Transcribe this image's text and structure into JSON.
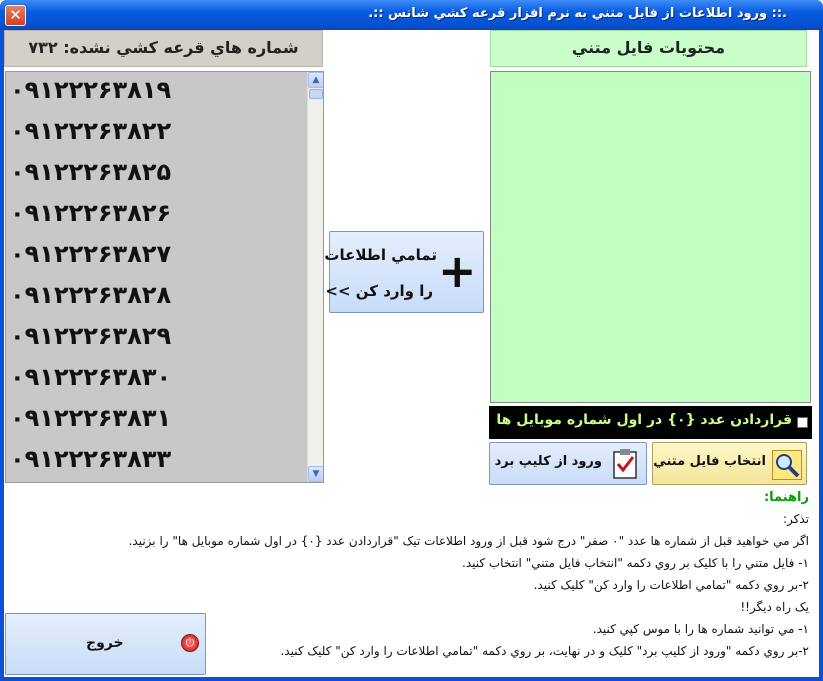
{
  "window": {
    "title": ".:: ورود اطلاعات از فايل متني به نرم افزار قرعه كشي شانس ::."
  },
  "left_panel": {
    "header": "شماره هاي قرعه كشي نشده: ۷۳۲",
    "numbers": [
      "۰۹۱۲۲۲۶۳۸۱۹",
      "۰۹۱۲۲۲۶۳۸۲۲",
      "۰۹۱۲۲۲۶۳۸۲۵",
      "۰۹۱۲۲۲۶۳۸۲۶",
      "۰۹۱۲۲۲۶۳۸۲۷",
      "۰۹۱۲۲۲۶۳۸۲۸",
      "۰۹۱۲۲۲۶۳۸۲۹",
      "۰۹۱۲۲۲۶۳۸۳۰",
      "۰۹۱۲۲۲۶۳۸۳۱",
      "۰۹۱۲۲۲۶۳۸۳۳"
    ]
  },
  "center": {
    "import_line1": "تمامي اطلاعات",
    "import_line2": "را وارد كن >>"
  },
  "right_panel": {
    "header": "محتويات فايل متني",
    "checkbox_label": "قراردادن عدد {۰} در اول شماره موبايل ها",
    "choose_file": "انتخاب فايل متني",
    "clipboard": "ورود از كليپ برد"
  },
  "help": {
    "title": "راهنما:",
    "lines": [
      "تذكر:",
      "اگر مي خواهيد قبل از شماره ها عدد \"۰ صفر\" درج شود قبل از ورود اطلاعات تيک \"قراردادن عدد {۰} در اول شماره موبايل ها\" را بزنيد.",
      "۱- فايل متني را با كليک بر روي دكمه \"انتخاب فايل متني\" انتخاب كنيد.",
      "۲-بر روي دكمه \"تمامي اطلاعات را وارد كن\" كليک كنيد.",
      "يک راه ديگر!!",
      "۱- مي توانيد شماره ها را با موس كپي كنيد.",
      "۲-بر روي دكمه \"ورود از كليپ برد\" كليک و در نهايت، بر روي دكمه \"تمامي اطلاعات را وارد كن\" كليک كنيد."
    ]
  },
  "exit": {
    "label": "خروج"
  },
  "icons": {
    "close": "close-icon",
    "search": "magnifier-icon",
    "clipboard": "clipboard-check-icon",
    "power": "power-icon",
    "plus": "plus-icon"
  }
}
